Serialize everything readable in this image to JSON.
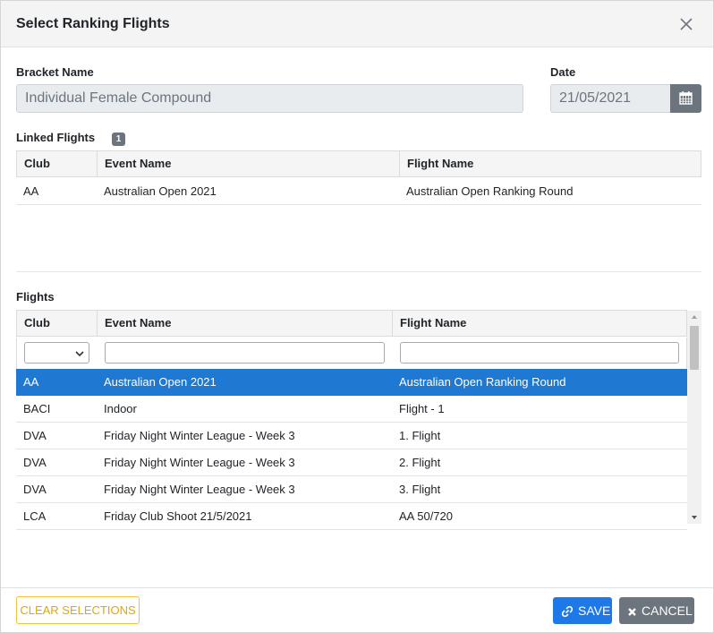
{
  "modal": {
    "title": "Select Ranking Flights"
  },
  "bracket": {
    "label": "Bracket Name",
    "value": "Individual Female Compound"
  },
  "date": {
    "label": "Date",
    "value": "21/05/2021"
  },
  "linked": {
    "label": "Linked Flights",
    "count": "1",
    "columns": [
      "Club",
      "Event Name",
      "Flight Name"
    ],
    "rows": [
      {
        "club": "AA",
        "event": "Australian Open 2021",
        "flight": "Australian Open Ranking Round"
      }
    ]
  },
  "flights": {
    "label": "Flights",
    "columns": [
      "Club",
      "Event Name",
      "Flight Name"
    ],
    "rows": [
      {
        "club": "AA",
        "event": "Australian Open 2021",
        "flight": "Australian Open Ranking Round"
      },
      {
        "club": "BACI",
        "event": "Indoor",
        "flight": "Flight - 1"
      },
      {
        "club": "DVA",
        "event": "Friday Night Winter League - Week 3",
        "flight": "1. Flight"
      },
      {
        "club": "DVA",
        "event": "Friday Night Winter League - Week 3",
        "flight": "2. Flight"
      },
      {
        "club": "DVA",
        "event": "Friday Night Winter League - Week 3",
        "flight": "3. Flight"
      },
      {
        "club": "LCA",
        "event": "Friday Club Shoot 21/5/2021",
        "flight": "AA 50/720"
      }
    ]
  },
  "footer": {
    "clear_label": "CLEAR SELECTIONS",
    "save_label": "SAVE",
    "cancel_label": "CANCEL"
  },
  "icons": {
    "close": "close-icon",
    "calendar": "calendar-icon",
    "save": "link-icon",
    "cancel": "times-icon"
  },
  "colors": {
    "selected_row": "#1f78d1",
    "save_button": "#1f78e8",
    "cancel_button": "#6c757d",
    "clear_border": "#f0c040"
  }
}
